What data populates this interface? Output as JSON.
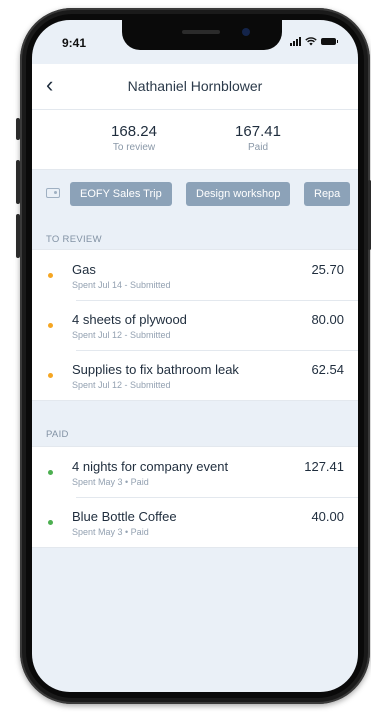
{
  "status": {
    "time": "9:41"
  },
  "header": {
    "back_glyph": "‹",
    "title": "Nathaniel Hornblower"
  },
  "totals": [
    {
      "amount": "168.24",
      "label": "To review"
    },
    {
      "amount": "167.41",
      "label": "Paid"
    }
  ],
  "tags": [
    "EOFY Sales Trip",
    "Design workshop",
    "Repa"
  ],
  "to_review": {
    "label": "TO REVIEW",
    "items": [
      {
        "name": "Gas",
        "sub": "Spent Jul 14 - Submitted",
        "amount": "25.70"
      },
      {
        "name": "4 sheets of plywood",
        "sub": "Spent Jul 12 - Submitted",
        "amount": "80.00"
      },
      {
        "name": "Supplies to fix bathroom leak",
        "sub": "Spent Jul 12 - Submitted",
        "amount": "62.54"
      }
    ]
  },
  "paid": {
    "label": "PAID",
    "items": [
      {
        "name": "4 nights for company event",
        "sub": "Spent May 3 • Paid",
        "amount": "127.41"
      },
      {
        "name": "Blue Bottle Coffee",
        "sub": "Spent May 3 • Paid",
        "amount": "40.00"
      }
    ]
  },
  "colors": {
    "review_dot": "#f5a623",
    "paid_dot": "#4caf50",
    "chip_bg": "#8ca2b8",
    "screen_bg": "#eaf0f7"
  },
  "icons": [
    "back-chevron-icon",
    "signal-icon",
    "wifi-icon",
    "battery-icon",
    "tag-icon"
  ]
}
